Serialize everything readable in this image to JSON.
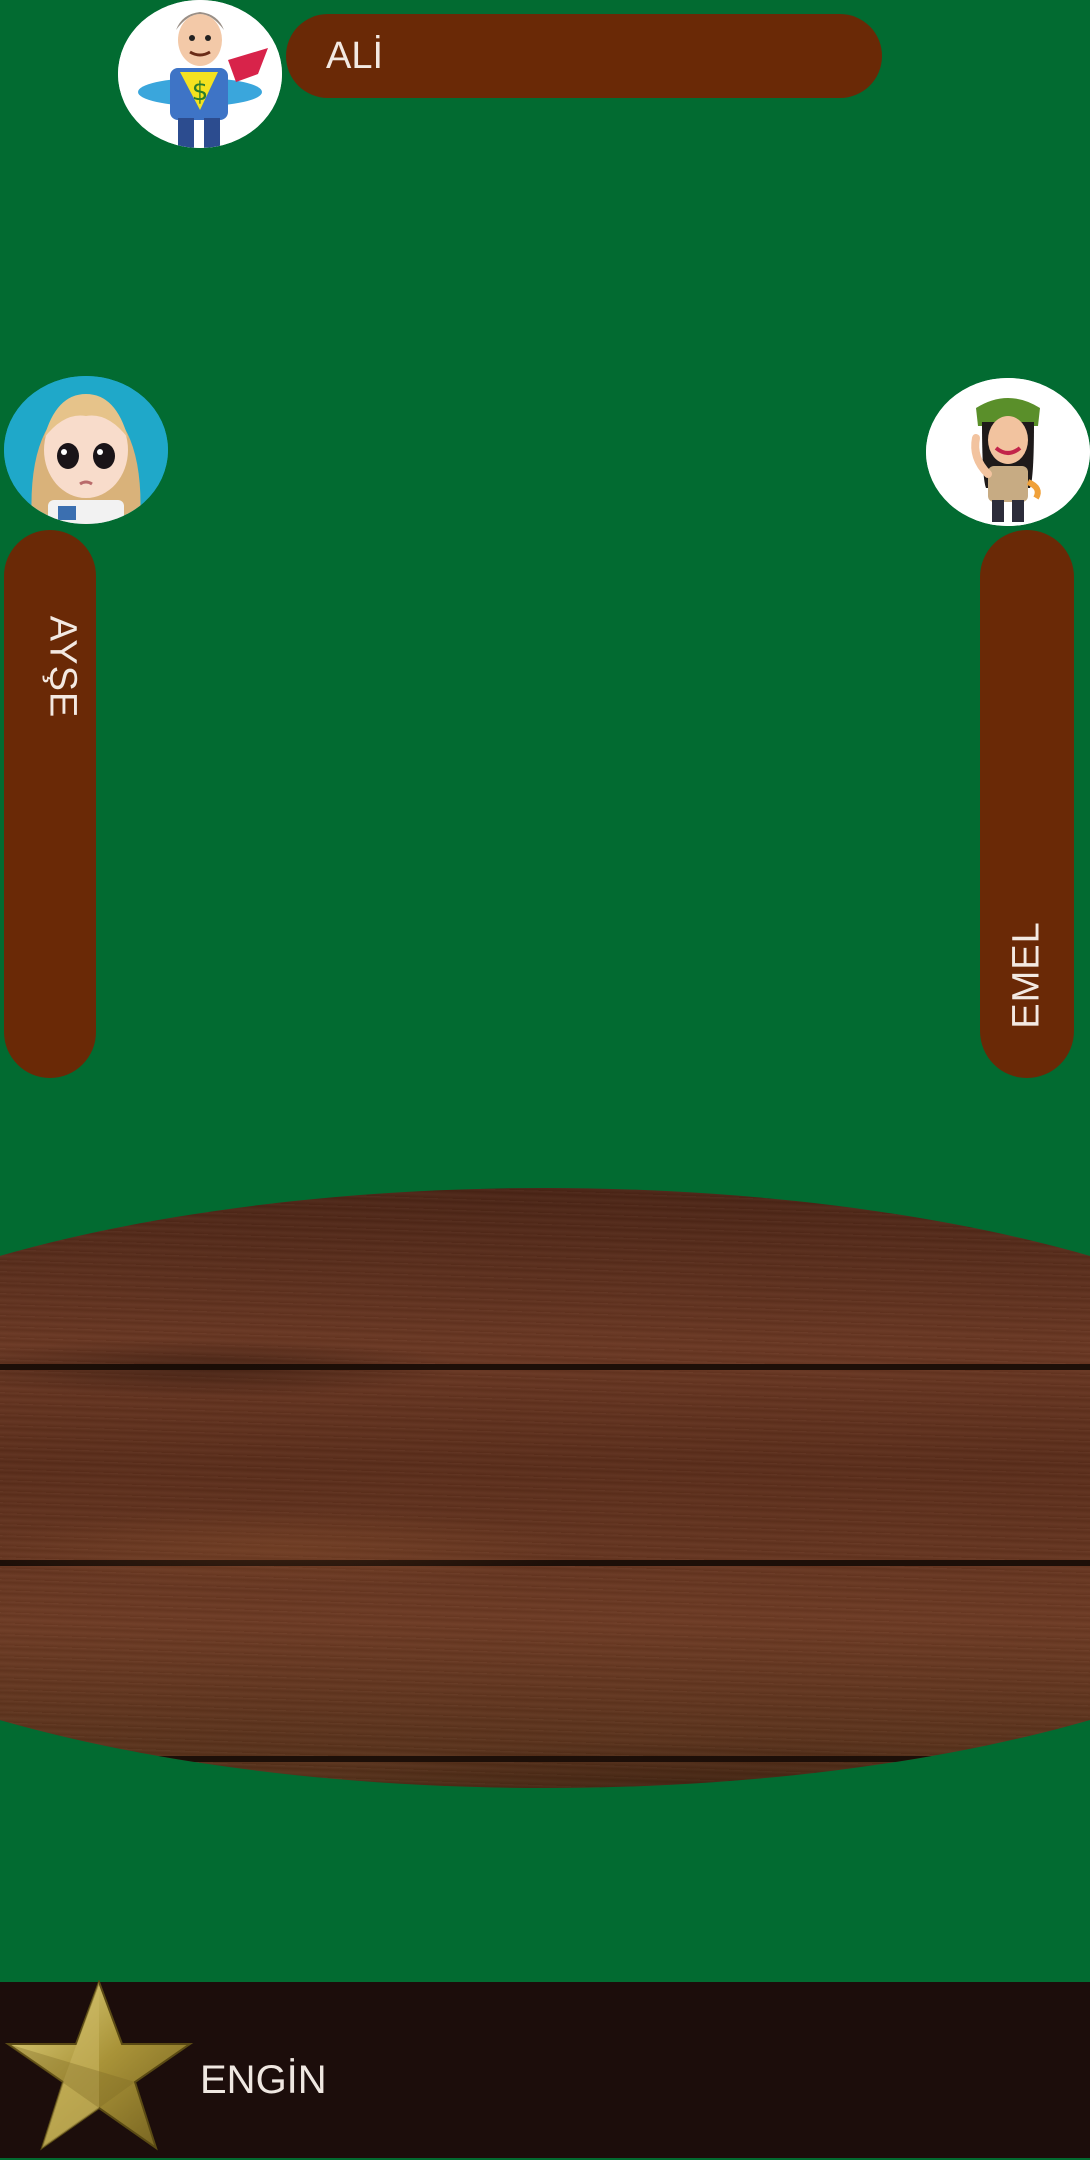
{
  "players": {
    "top": {
      "name": "ALİ",
      "avatar": "businessman-superhero-avatar"
    },
    "left": {
      "name": "AYŞE",
      "avatar": "blonde-girl-avatar"
    },
    "right": {
      "name": "EMEL",
      "avatar": "waving-woman-avatar"
    },
    "bottom": {
      "name": "ENGİN",
      "badge": "gold-star-icon"
    }
  },
  "colors": {
    "felt": "#026b31",
    "name_bar": "#6a2906",
    "bottom_bar": "#1c0d0b",
    "name_text": "#f3e9e2"
  }
}
